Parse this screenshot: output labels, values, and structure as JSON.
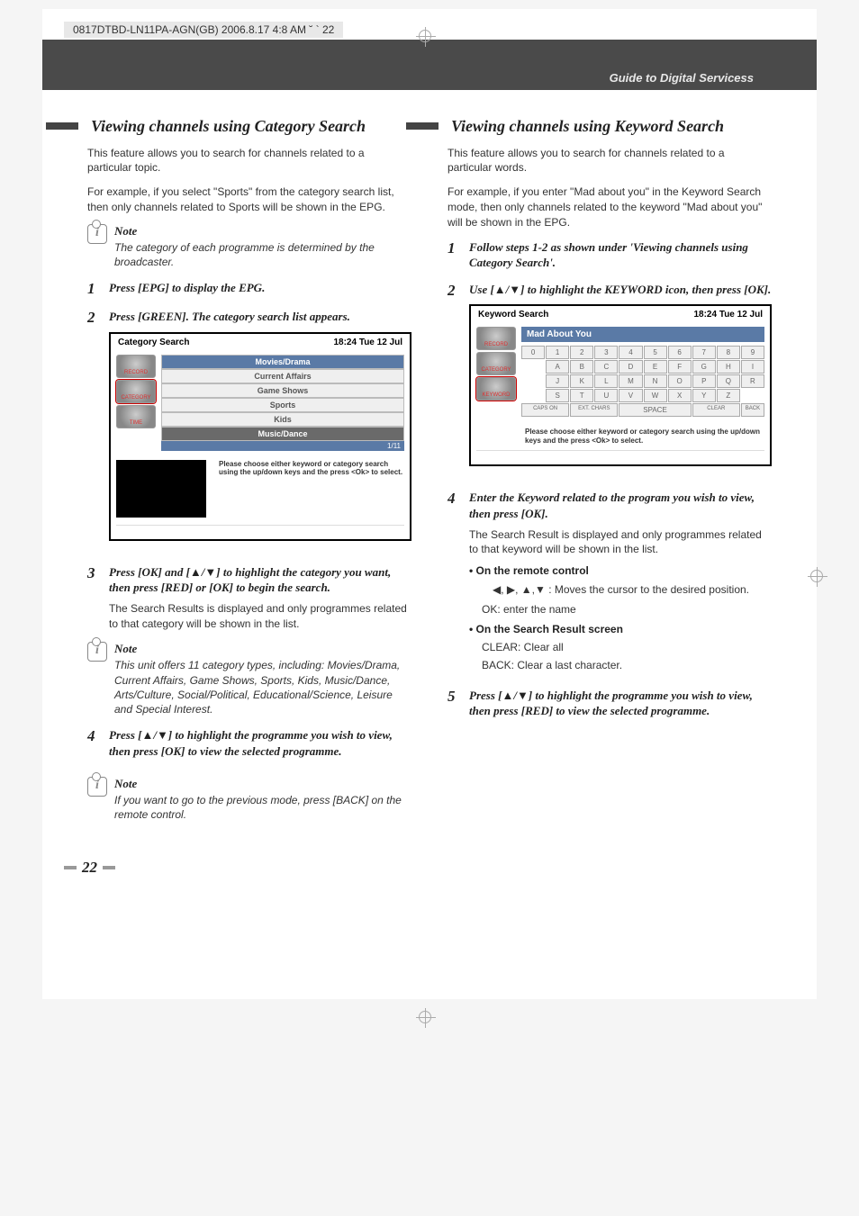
{
  "header_tag": "0817DTBD-LN11PA-AGN(GB)  2006.8.17 4:8 AM  ˘ ` 22",
  "guide_label": "Guide to Digital Servicess",
  "page_number": "22",
  "left": {
    "title": "Viewing channels using Category Search",
    "intro1": "This feature allows you to search for channels related to a particular topic.",
    "intro2": "For example, if you select \"Sports\" from the category search list, then only channels related to Sports will be shown in the EPG.",
    "note1_label": "Note",
    "note1": "The category of each programme is determined by the broadcaster.",
    "step1": "Press [EPG] to display the EPG.",
    "step2": "Press [GREEN]. The category search list appears.",
    "ui": {
      "title": "Category Search",
      "time": "18:24 Tue 12 Jul",
      "cats": [
        "Movies/Drama",
        "Current Affairs",
        "Game Shows",
        "Sports",
        "Kids",
        "Music/Dance"
      ],
      "pager": "1/11",
      "hint": "Please choose either keyword or category search using the up/down keys and the press <Ok> to select.",
      "icons": [
        "RECORD",
        "CATEGORY",
        "TIME"
      ]
    },
    "step3": "Press [OK] and [▲/▼] to highlight the category you want, then press [RED] or [OK] to begin the search.",
    "step3_sub": "The Search Results is displayed  and only programmes related to that category will be shown in the list.",
    "note2_label": "Note",
    "note2": "This unit offers 11 category types, including: Movies/Drama, Current Affairs, Game Shows, Sports, Kids, Music/Dance, Arts/Culture, Social/Political, Educational/Science, Leisure and Special Interest.",
    "step4": "Press [▲/▼] to highlight the programme you wish to view, then press [OK] to view the selected programme.",
    "note3_label": "Note",
    "note3": "If you want to go to the previous mode, press [BACK] on the remote control."
  },
  "right": {
    "title": "Viewing channels using Keyword Search",
    "intro1": "This feature allows you to search for channels related to a particular words.",
    "intro2": "For example, if you enter \"Mad about you\" in the Keyword Search mode, then only channels related to the keyword \"Mad about you\" will be shown in the EPG.",
    "step1": "Follow steps 1-2 as shown under 'Viewing channels using Category Search'.",
    "step2": "Use [▲/▼] to highlight the KEYWORD icon, then press [OK].",
    "ui": {
      "title": "Keyword Search",
      "time": "18:24 Tue 12 Jul",
      "entry": "Mad About You",
      "row1": [
        "0",
        "1",
        "2",
        "3",
        "4",
        "5",
        "6",
        "7",
        "8",
        "9"
      ],
      "row2": [
        "A",
        "B",
        "C",
        "D",
        "E",
        "F",
        "G",
        "H",
        "I"
      ],
      "row3": [
        "J",
        "K",
        "L",
        "M",
        "N",
        "O",
        "P",
        "Q",
        "R"
      ],
      "row4": [
        "S",
        "T",
        "U",
        "V",
        "W",
        "X",
        "Y",
        "Z"
      ],
      "row5": [
        "CAPS ON",
        "EXT. CHARS",
        "SPACE",
        "CLEAR",
        "BACK"
      ],
      "hint": "Please choose either keyword or category search using the up/down keys and the press <Ok> to select.",
      "icons": [
        "RECORD",
        "CATEGORY",
        "KEYWORD"
      ]
    },
    "step4": "Enter the Keyword related to the program you wish to view, then press [OK].",
    "step4_sub": "The Search Result is displayed and only programmes related to that keyword will be shown in the list.",
    "bullet1": "• On the remote control",
    "arrows_text": "◀, ▶, ▲,▼ : Moves the cursor to the desired position.",
    "ok_text": "OK: enter the name",
    "bullet2": "• On the Search Result screen",
    "clear_text": "CLEAR: Clear all",
    "back_text": "BACK: Clear a last character.",
    "step5": "Press [▲/▼] to highlight the programme you wish to view, then press [RED] to view the selected programme."
  }
}
